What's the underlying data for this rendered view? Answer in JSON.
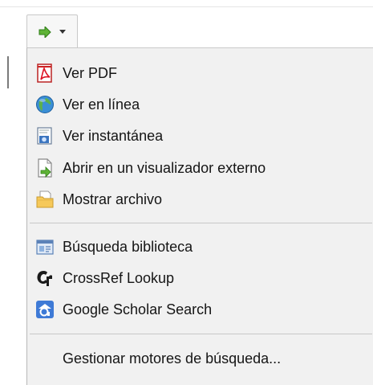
{
  "toolbar": {
    "button_icon": "green-arrow-icon",
    "dropdown_icon": "chevron-down-icon"
  },
  "menu": {
    "group1": [
      {
        "label": "Ver PDF",
        "icon": "pdf-icon"
      },
      {
        "label": "Ver en línea",
        "icon": "globe-icon"
      },
      {
        "label": "Ver instantánea",
        "icon": "snapshot-icon"
      },
      {
        "label": "Abrir en un visualizador externo",
        "icon": "external-viewer-icon"
      },
      {
        "label": "Mostrar archivo",
        "icon": "folder-icon"
      }
    ],
    "group2": [
      {
        "label": "Búsqueda biblioteca",
        "icon": "library-search-icon"
      },
      {
        "label": "CrossRef Lookup",
        "icon": "crossref-icon"
      },
      {
        "label": "Google Scholar Search",
        "icon": "google-scholar-icon"
      }
    ],
    "manage_label": "Gestionar motores de búsqueda..."
  }
}
